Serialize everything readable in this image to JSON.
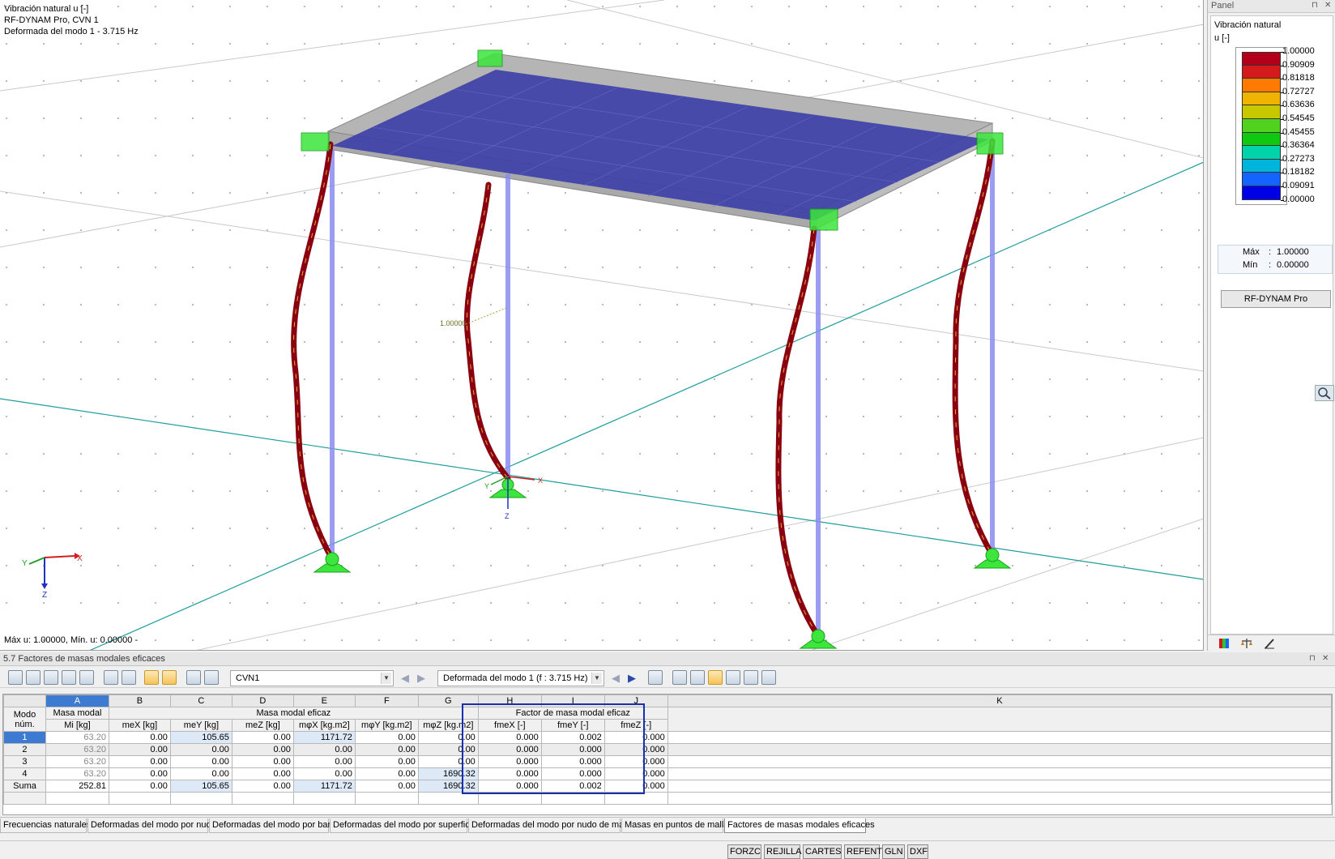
{
  "viewport": {
    "info_line1": "Vibración natural u [-]",
    "info_line2": "RF-DYNAM Pro, CVN 1",
    "info_line3": "Deformada del modo 1 - 3.715 Hz",
    "bottom_text": "Máx u: 1.00000, Mín. u: 0.00000 -",
    "value_label": "1.00000",
    "axis_x": "X",
    "axis_y": "Y",
    "axis_z": "Z"
  },
  "panel": {
    "title": "Panel",
    "heading1": "Vibración natural",
    "heading2": "u [-]",
    "legend_values": [
      "1.00000",
      "0.90909",
      "0.81818",
      "0.72727",
      "0.63636",
      "0.54545",
      "0.45455",
      "0.36364",
      "0.27273",
      "0.18182",
      "0.09091",
      "0.00000"
    ],
    "legend_colors": [
      "#b3001a",
      "#d41a1a",
      "#ff7a00",
      "#f0b400",
      "#c8c800",
      "#50d21e",
      "#10c810",
      "#00d2aa",
      "#00b4dc",
      "#1464ff",
      "#0000e6",
      "#00007a"
    ],
    "max_label": "Máx",
    "max_value": "1.00000",
    "min_label": "Mín",
    "min_value": "0.00000",
    "button_label": "RF-DYNAM Pro"
  },
  "table_pane": {
    "title": "5.7 Factores de masas modales eficaces",
    "case_combo": "CVN1",
    "mode_combo": "Deformada del modo 1 (f : 3.715 Hz)",
    "col_letters": [
      "A",
      "B",
      "C",
      "D",
      "E",
      "F",
      "G",
      "H",
      "I",
      "J",
      "K"
    ],
    "hdr_mode_1": "Modo",
    "hdr_mode_2": "núm.",
    "hdr_masa_modal": "Masa modal",
    "hdr_masa_eficaz": "Masa modal eficaz",
    "hdr_factor": "Factor de masa modal eficaz",
    "sub_headers": [
      "Mi [kg]",
      "meX [kg]",
      "meY [kg]",
      "meZ [kg]",
      "mφX [kg.m2]",
      "mφY [kg.m2]",
      "mφZ [kg.m2]",
      "fmeX [-]",
      "fmeY [-]",
      "fmeZ [-]"
    ],
    "rows": [
      {
        "mode": "1",
        "cells": [
          "63.20",
          "0.00",
          "105.65",
          "0.00",
          "1171.72",
          "0.00",
          "0.00",
          "0.000",
          "0.002",
          "0.000"
        ]
      },
      {
        "mode": "2",
        "cells": [
          "63.20",
          "0.00",
          "0.00",
          "0.00",
          "0.00",
          "0.00",
          "0.00",
          "0.000",
          "0.000",
          "0.000"
        ]
      },
      {
        "mode": "3",
        "cells": [
          "63.20",
          "0.00",
          "0.00",
          "0.00",
          "0.00",
          "0.00",
          "0.00",
          "0.000",
          "0.000",
          "0.000"
        ]
      },
      {
        "mode": "4",
        "cells": [
          "63.20",
          "0.00",
          "0.00",
          "0.00",
          "0.00",
          "0.00",
          "1690.32",
          "0.000",
          "0.000",
          "0.000"
        ]
      },
      {
        "mode": "Suma",
        "cells": [
          "252.81",
          "0.00",
          "105.65",
          "0.00",
          "1171.72",
          "0.00",
          "1690.32",
          "0.000",
          "0.002",
          "0.000"
        ]
      }
    ],
    "tabs": [
      "Frecuencias naturales",
      "Deformadas del modo por nudo",
      "Deformadas del modo por barra",
      "Deformadas del modo por superficie",
      "Deformadas del modo por nudo de malla",
      "Masas en puntos de malla",
      "Factores de masas modales eficaces"
    ]
  },
  "statusbar": {
    "buttons": [
      "FORZC",
      "REJILLA",
      "CARTES",
      "REFENT",
      "GLN",
      "DXF"
    ]
  }
}
